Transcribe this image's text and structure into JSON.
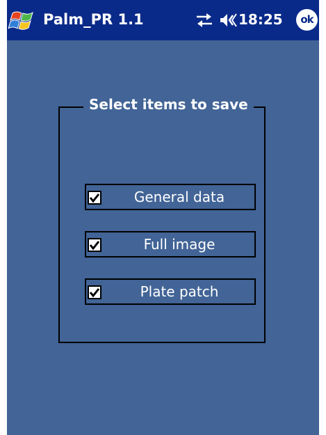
{
  "titlebar": {
    "app_title": "Palm_PR 1.1",
    "clock": "18:25",
    "ok_label": "ok",
    "start_icon": "windows-flag-icon",
    "connectivity_icon": "connectivity-arrows-icon",
    "volume_icon": "speaker-volume-icon"
  },
  "save_group": {
    "legend": "Select items to save",
    "items": [
      {
        "label": "General data",
        "checked": true
      },
      {
        "label": "Full image",
        "checked": true
      },
      {
        "label": "Plate patch",
        "checked": true
      }
    ]
  },
  "colors": {
    "titlebar": "#0a2a8a",
    "background": "#426496",
    "text": "#ffffff",
    "border": "#000000"
  }
}
